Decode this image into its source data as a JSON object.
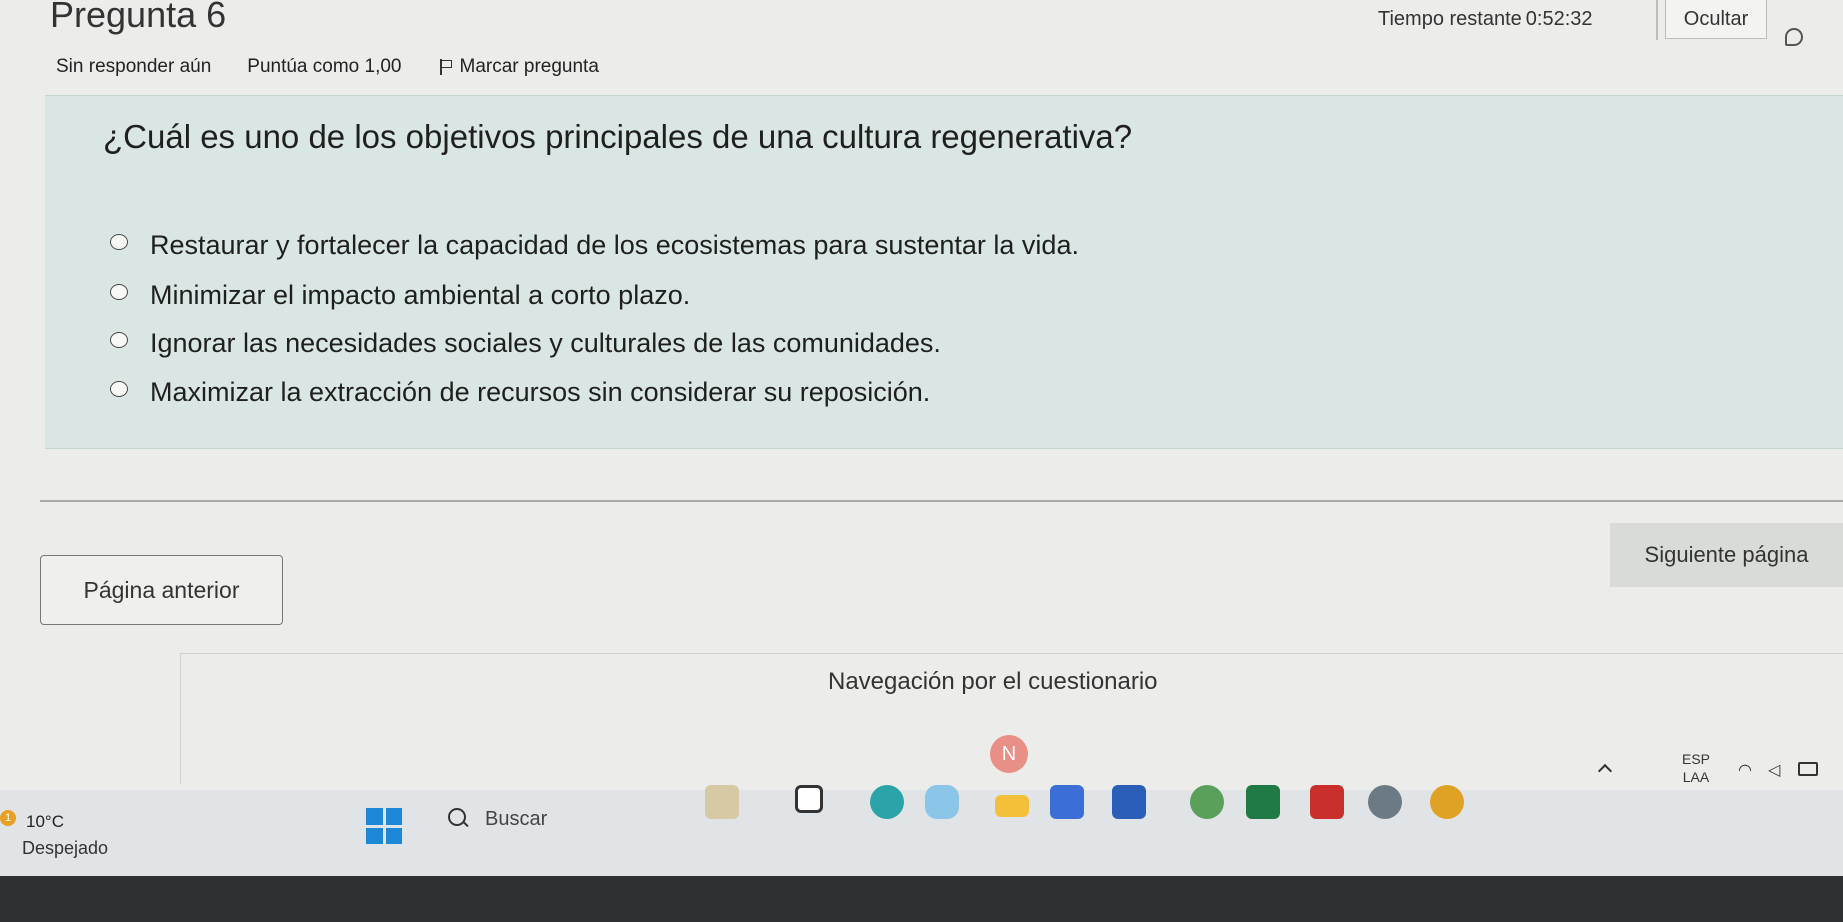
{
  "header": {
    "question_title": "Pregunta 6",
    "time_label": "Tiempo restante",
    "time_value": "0:52:32",
    "hide_label": "Ocultar",
    "status": "Sin responder aún",
    "score": "Puntúa como 1,00",
    "flag_label": "Marcar pregunta"
  },
  "question": {
    "text": "¿Cuál es uno de los objetivos principales de una cultura regenerativa?",
    "options": [
      "Restaurar y fortalecer la capacidad de los ecosistemas para sustentar la vida.",
      "Minimizar el impacto ambiental a corto plazo.",
      "Ignorar las necesidades sociales y culturales de las comunidades.",
      "Maximizar la extracción de recursos sin considerar su reposición."
    ]
  },
  "navigation": {
    "prev_label": "Página anterior",
    "next_label": "Siguiente página",
    "quiz_nav_title": "Navegación por el cuestionario",
    "badge": "N"
  },
  "taskbar": {
    "weather_badge": "1",
    "temperature": "10°C",
    "weather_desc": "Despejado",
    "search_label": "Buscar",
    "lang_1": "ESP",
    "lang_2": "LAA",
    "apps": [
      "widgets-icon",
      "files-icon",
      "edge-icon",
      "copilot-icon",
      "folder-icon",
      "store-icon",
      "word-icon",
      "chrome-icon",
      "excel-icon",
      "acrobat-icon",
      "settings-icon",
      "chrome-alt-icon"
    ],
    "accent": "#1e88d8"
  }
}
